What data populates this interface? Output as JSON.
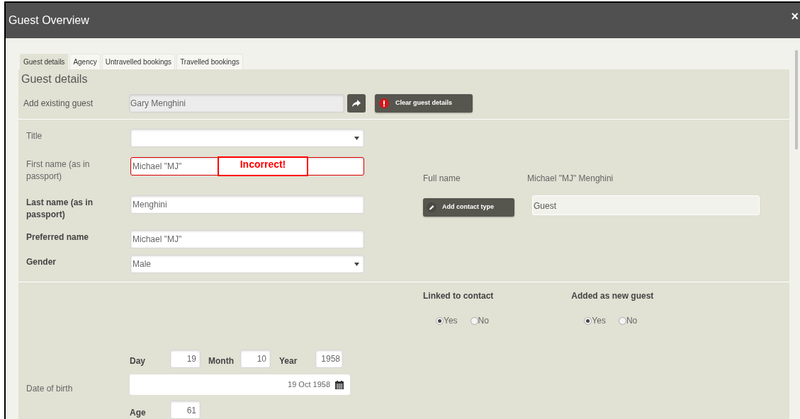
{
  "window": {
    "title": "Guest Overview",
    "close": "×"
  },
  "tabs": [
    {
      "label": "Guest details",
      "selected": true
    },
    {
      "label": "Agency",
      "selected": false
    },
    {
      "label": "Untravelled bookings",
      "selected": false
    },
    {
      "label": "Travelled bookings",
      "selected": false
    }
  ],
  "section_title": "Guest details",
  "existing_guest": {
    "label": "Add existing guest",
    "value": "Gary  Menghini",
    "clear_button": "Clear guest details"
  },
  "fields": [
    {
      "kind": "select",
      "label": "Title",
      "emphasized": false,
      "error": false
    },
    {
      "kind": "text",
      "label": "First name (as in passport)",
      "value": "Michael \"MJ\"",
      "emphasized": false,
      "error": true
    },
    {
      "kind": "text",
      "label": "Last name (as in passport)",
      "value": "Menghini",
      "emphasized": true,
      "error": false
    },
    {
      "kind": "text",
      "label": "Preferred name",
      "value": "Michael \"MJ\"",
      "emphasized": true,
      "error": false
    },
    {
      "kind": "select",
      "label": "Gender",
      "value": "Male",
      "emphasized": true,
      "error": false
    }
  ],
  "annotation": {
    "text": "Incorrect!"
  },
  "full_name": {
    "label": "Full name",
    "value": "Michael \"MJ\" Menghini"
  },
  "contact_type": {
    "button": "Add contact type",
    "value": "Guest"
  },
  "radio_groups": [
    {
      "label": "Linked to contact",
      "options": [
        {
          "label": "Yes",
          "selected": true
        },
        {
          "label": "No",
          "selected": false
        }
      ]
    },
    {
      "label": "Added as new guest",
      "options": [
        {
          "label": "Yes",
          "selected": true
        },
        {
          "label": "No",
          "selected": false
        }
      ]
    }
  ],
  "dob": {
    "day_label": "Day",
    "day": "19",
    "month_label": "Month",
    "month": "10",
    "year_label": "Year",
    "year": "1958",
    "label": "Date of birth",
    "value": "19 Oct 1958",
    "age_label": "Age",
    "age": "61"
  }
}
